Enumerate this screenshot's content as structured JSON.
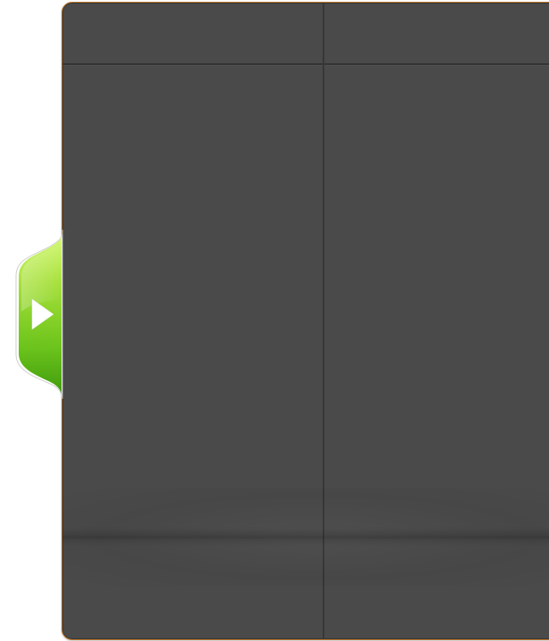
{
  "panel": {
    "colors": {
      "background": "#4a4a4a",
      "border": "#b9732a",
      "divider": "#373737"
    }
  },
  "side_tab": {
    "icon": "play-arrow-icon",
    "colors": {
      "fill_light": "#b6ee4e",
      "fill_dark": "#4faa12",
      "arrow": "#ffffff"
    }
  }
}
